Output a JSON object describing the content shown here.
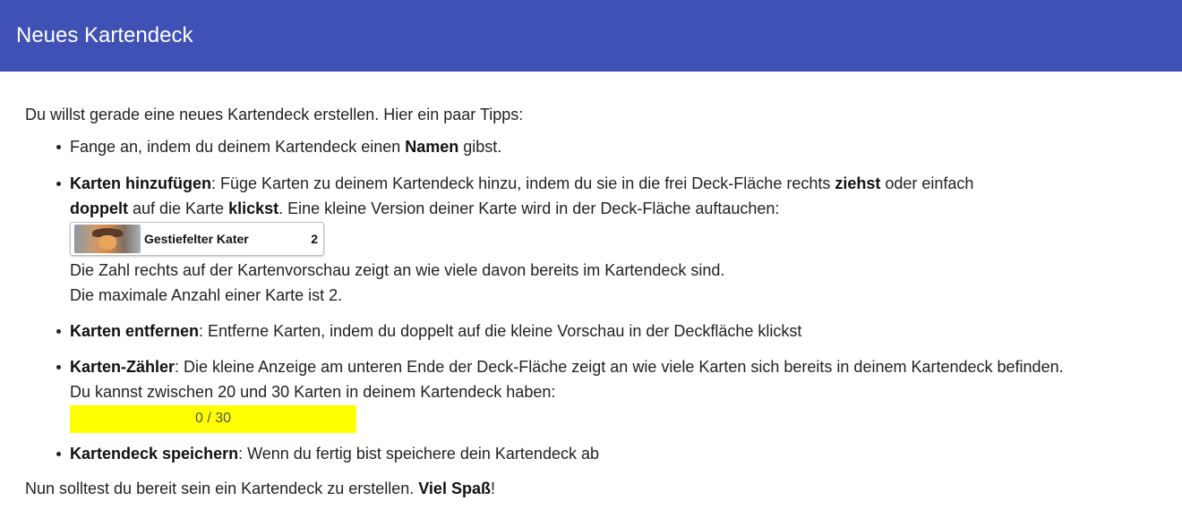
{
  "header": {
    "title": "Neues Kartendeck"
  },
  "intro": "Du willst gerade eine neues Kartendeck erstellen. Hier ein paar Tipps:",
  "tips": {
    "name": {
      "pre": "Fange an, indem du deinem Kartendeck einen ",
      "bold": "Namen",
      "post": " gibst."
    },
    "add": {
      "title": "Karten hinzufügen",
      "text1": ": Füge Karten zu deinem Kartendeck hinzu, indem du sie in die frei Deck-Fläche rechts ",
      "bold1": "ziehst",
      "text2": " oder einfach ",
      "bold2": "doppelt",
      "text3": " auf die Karte ",
      "bold3": "klickst",
      "text4": ". Eine kleine Version deiner Karte wird in der Deck-Fläche auftauchen:",
      "card_preview": {
        "name": "Gestiefelter Kater",
        "count": "2",
        "thumb": "puss-in-boots-image"
      },
      "note1": "Die Zahl rechts auf der Kartenvorschau zeigt an wie viele davon bereits im Kartendeck sind.",
      "note2": "Die maximale Anzahl einer Karte ist 2."
    },
    "remove": {
      "title": "Karten entfernen",
      "text": ": Entferne Karten, indem du doppelt auf die kleine Vorschau in der Deckfläche klickst"
    },
    "counter": {
      "title": "Karten-Zähler",
      "text": ": Die kleine Anzeige am unteren Ende der Deck-Fläche zeigt an wie viele Karten sich bereits in deinem Kartendeck befinden.",
      "text2": "Du kannst zwischen 20 und 30 Karten in deinem Kartendeck haben:",
      "display": "0 / 30",
      "color": "#ffff00"
    },
    "save": {
      "title": "Kartendeck speichern",
      "text": ": Wenn du fertig bist speichere dein Kartendeck ab"
    }
  },
  "outro": {
    "text": "Nun solltest du bereit sein ein Kartendeck zu erstellen. ",
    "bold": "Viel Spaß",
    "end": "!"
  },
  "colors": {
    "header": "#3f51b5",
    "header_text": "#ffffff"
  }
}
